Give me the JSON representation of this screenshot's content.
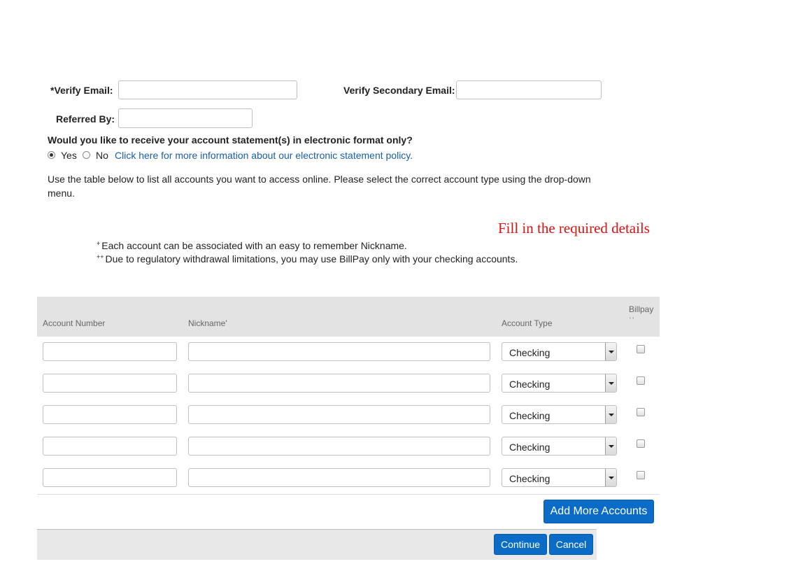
{
  "form": {
    "verify_email_label": "*Verify Email:",
    "verify_email_value": "",
    "verify_secondary_email_label": "Verify Secondary Email:",
    "verify_secondary_email_value": "",
    "referred_by_label": "Referred By:",
    "referred_by_value": ""
  },
  "estatement": {
    "question": "Would you like to receive your account statement(s) in electronic format only?",
    "options": [
      {
        "label": "Yes",
        "selected": true
      },
      {
        "label": "No",
        "selected": false
      }
    ],
    "policy_link": "Click here for more information about our electronic statement policy."
  },
  "instructions": "Use the table below to list all accounts you want to access online. Please select the correct account type using the drop-down menu.",
  "notice": "Fill in the required details",
  "notes": [
    {
      "marker": "+",
      "text": "Each account can be associated with an easy to remember Nickname."
    },
    {
      "marker": "++",
      "text": "Due to regulatory withdrawal limitations, you may use BillPay only with your checking accounts."
    }
  ],
  "table": {
    "headers": {
      "account_number": "Account Number",
      "nickname": "Nickname'",
      "account_type": "Account Type",
      "billpay": "Billpay",
      "billpay_marker": "' '"
    },
    "rows": [
      {
        "account_number": "",
        "nickname": "",
        "account_type": "Checking",
        "billpay": false
      },
      {
        "account_number": "",
        "nickname": "",
        "account_type": "Checking",
        "billpay": false
      },
      {
        "account_number": "",
        "nickname": "",
        "account_type": "Checking",
        "billpay": false
      },
      {
        "account_number": "",
        "nickname": "",
        "account_type": "Checking",
        "billpay": false
      },
      {
        "account_number": "",
        "nickname": "",
        "account_type": "Checking",
        "billpay": false
      }
    ]
  },
  "buttons": {
    "add_more": "Add More Accounts",
    "continue": "Continue",
    "cancel": "Cancel"
  },
  "colors": {
    "primary_button": "#0a6cc7",
    "notice": "#e01010",
    "link": "#1a5ea8"
  }
}
